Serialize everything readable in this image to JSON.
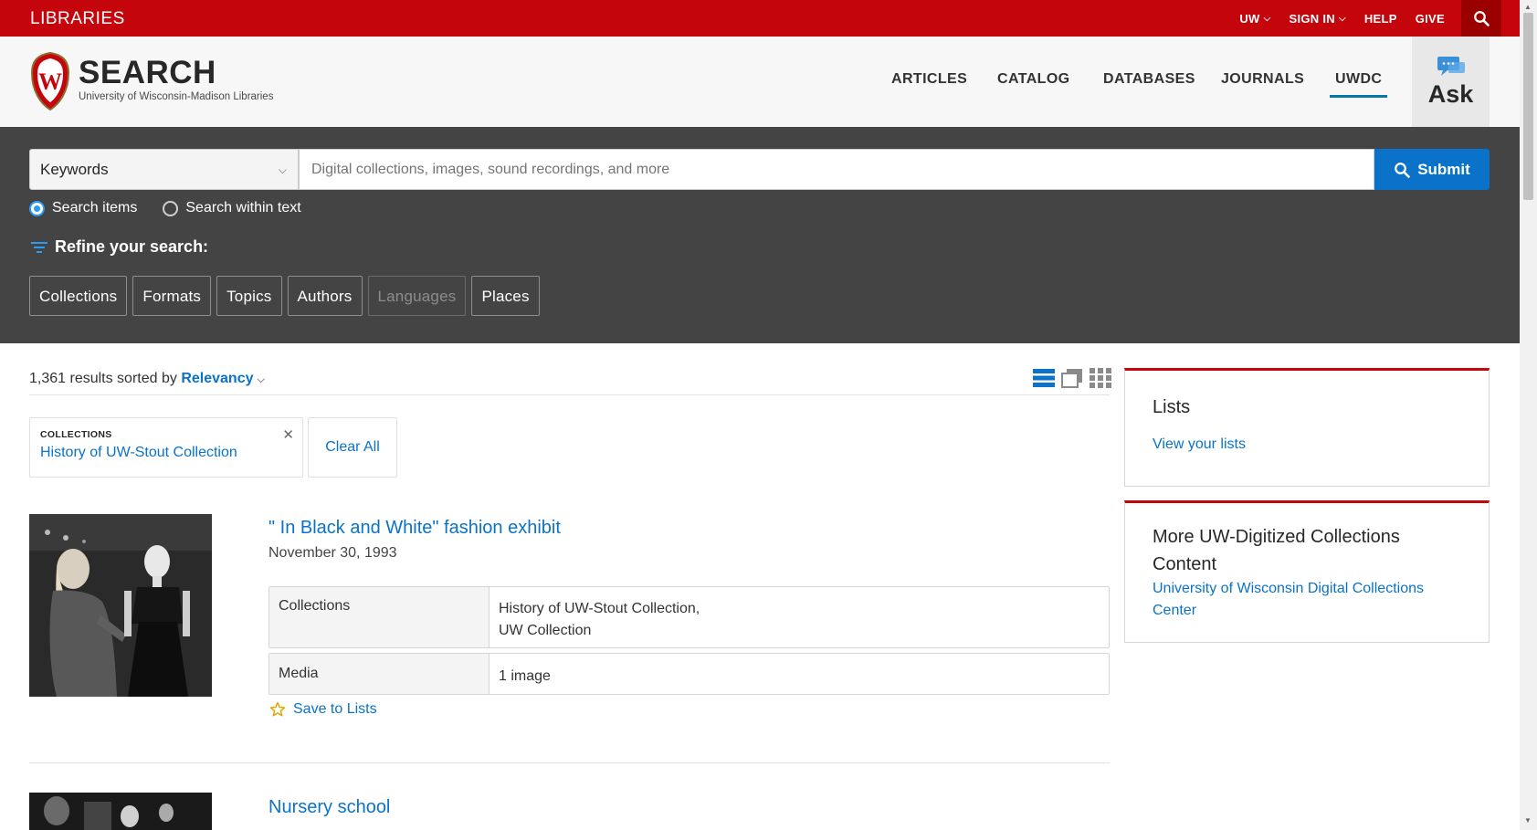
{
  "topbar": {
    "brand": "LIBRARIES",
    "nav": [
      {
        "label": "UW",
        "dropdown": true
      },
      {
        "label": "SIGN IN",
        "dropdown": true
      },
      {
        "label": "HELP",
        "dropdown": false
      },
      {
        "label": "GIVE",
        "dropdown": false
      }
    ],
    "search_icon": "search-icon"
  },
  "header": {
    "title": "SEARCH",
    "subtitle": "University of Wisconsin-Madison Libraries",
    "nav": [
      "ARTICLES",
      "CATALOG",
      "DATABASES",
      "JOURNALS",
      "UWDC"
    ],
    "active_nav": "UWDC",
    "ask_label": "Ask"
  },
  "search": {
    "scope": "Keywords",
    "placeholder": "Digital collections, images, sound recordings, and more",
    "submit_label": "Submit",
    "radios": [
      {
        "label": "Search items",
        "checked": true
      },
      {
        "label": "Search within text",
        "checked": false
      }
    ],
    "refine_label": "Refine your search:",
    "facets": [
      {
        "label": "Collections",
        "disabled": false
      },
      {
        "label": "Formats",
        "disabled": false
      },
      {
        "label": "Topics",
        "disabled": false
      },
      {
        "label": "Authors",
        "disabled": false
      },
      {
        "label": "Languages",
        "disabled": true
      },
      {
        "label": "Places",
        "disabled": false
      }
    ]
  },
  "results": {
    "count_text": "1,361 results sorted by",
    "sort_label": "Relevancy",
    "filter": {
      "category": "COLLECTIONS",
      "value": "History of UW-Stout Collection"
    },
    "clear_all": "Clear All",
    "items": [
      {
        "title": "\" In Black and White\" fashion exhibit",
        "date": "November 30, 1993",
        "collections_label": "Collections",
        "collections_lines": [
          "History of UW-Stout Collection,",
          "UW Collection"
        ],
        "media_label": "Media",
        "media_value": "1 image",
        "save_label": "Save to Lists"
      },
      {
        "title": "Nursery school"
      }
    ]
  },
  "sidebar": {
    "lists_title": "Lists",
    "lists_link": "View your lists",
    "more_title_1": "More UW-Digitized Collections",
    "more_title_2": "Content",
    "more_link_1": "University of Wisconsin Digital Collections",
    "more_link_2": "Center"
  },
  "colors": {
    "brand_red": "#c5050c",
    "link_blue": "#0a73c9",
    "panel_dark": "#444444"
  }
}
